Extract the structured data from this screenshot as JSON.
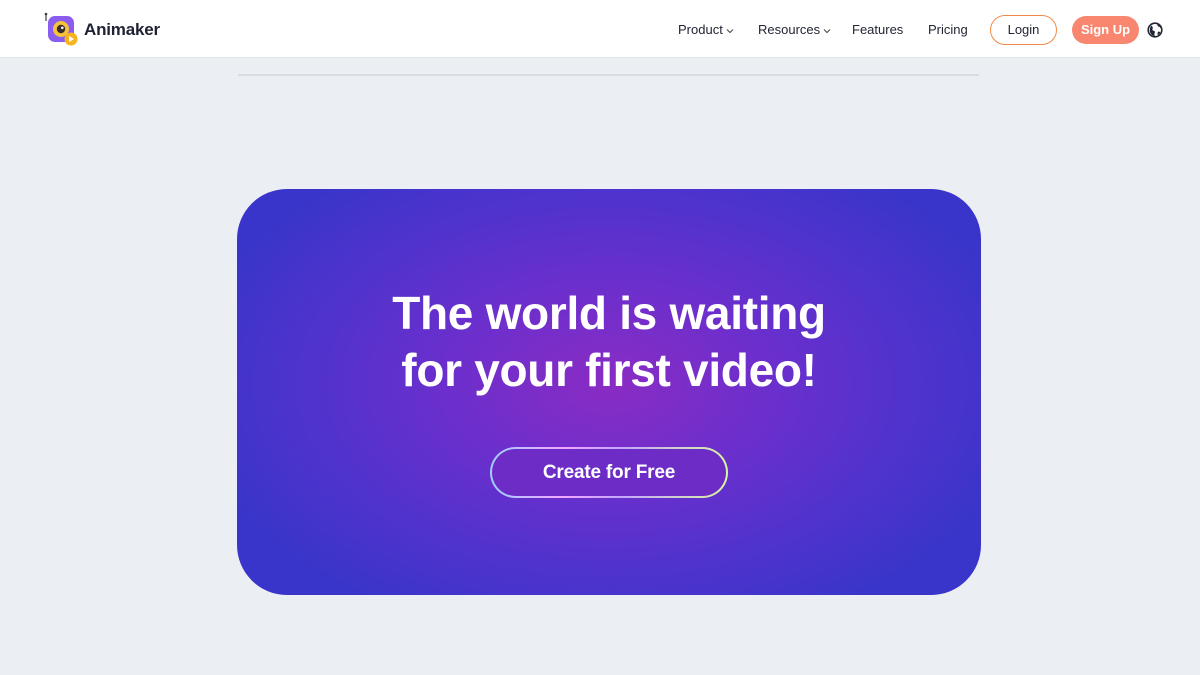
{
  "brand": {
    "name": "Animaker",
    "logo_icon": "animaker-logo-icon"
  },
  "nav": {
    "items": [
      {
        "label": "Product",
        "has_dropdown": true
      },
      {
        "label": "Resources",
        "has_dropdown": true
      },
      {
        "label": "Features",
        "has_dropdown": false
      },
      {
        "label": "Pricing",
        "has_dropdown": false
      }
    ],
    "login_label": "Login",
    "signup_label": "Sign Up",
    "language_icon": "globe-icon"
  },
  "cta": {
    "title_line1": "The world is waiting",
    "title_line2": "for your first video!",
    "button_label": "Create for Free"
  },
  "colors": {
    "accent_orange": "#f08a4b",
    "signup_bg": "#f9866f",
    "card_purple": "#6a2fcd",
    "card_blue": "#3a35ca",
    "page_bg": "#ebeef3"
  }
}
